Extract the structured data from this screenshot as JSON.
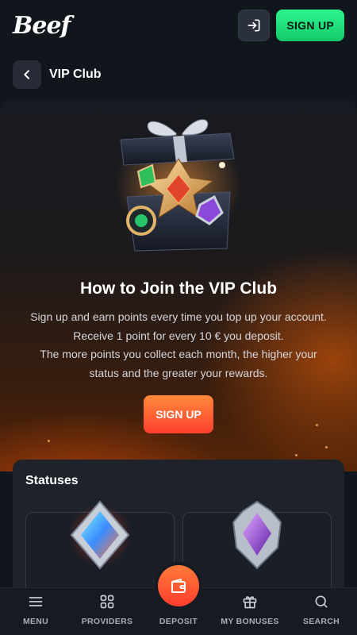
{
  "header": {
    "logo": "Beef",
    "signup_label": "SIGN UP"
  },
  "page": {
    "title": "VIP Club"
  },
  "hero": {
    "title": "How to Join the VIP Club",
    "lines": [
      "Sign up and earn points every time you top up your account.",
      "Receive 1 point for every 10 € you deposit.",
      "The more points you collect each month, the higher your",
      "status and the greater your rewards."
    ],
    "signup_label": "SIGN UP"
  },
  "statuses": {
    "title": "Statuses"
  },
  "nav": {
    "items": [
      {
        "label": "MENU",
        "icon": "menu-icon"
      },
      {
        "label": "PROVIDERS",
        "icon": "grid-icon"
      },
      {
        "label": "DEPOSIT",
        "icon": "wallet-icon"
      },
      {
        "label": "MY BONUSES",
        "icon": "gift-icon"
      },
      {
        "label": "SEARCH",
        "icon": "search-icon"
      }
    ]
  },
  "colors": {
    "accent_green": "#1fdc7a",
    "accent_orange": "#ff5a30",
    "background": "#11151c"
  }
}
